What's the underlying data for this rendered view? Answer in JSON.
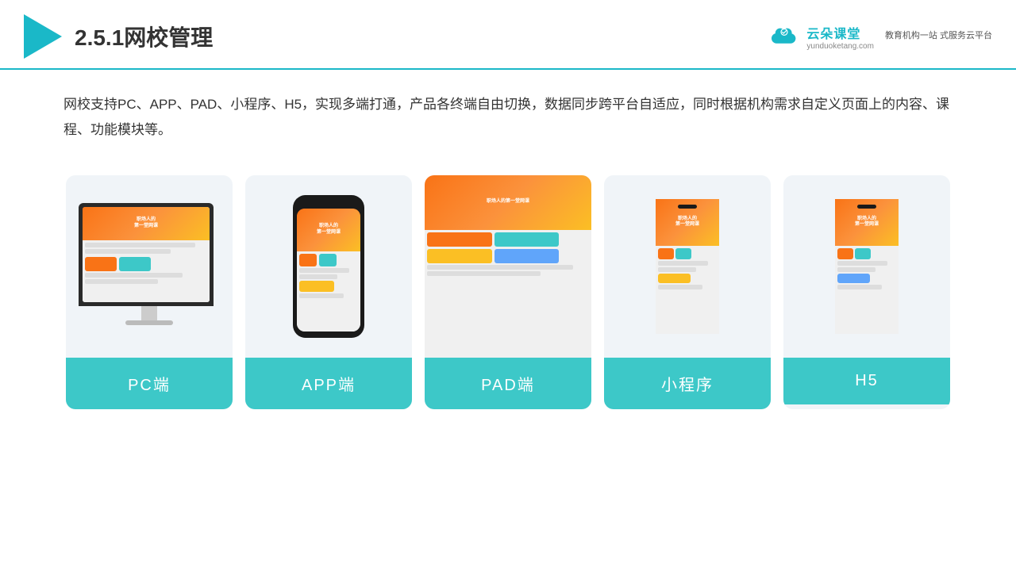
{
  "header": {
    "title": "2.5.1网校管理",
    "brand_name": "云朵课堂",
    "brand_url": "yunduoketang.com",
    "brand_tagline": "教育机构一站\n式服务云平台"
  },
  "description": {
    "text": "网校支持PC、APP、PAD、小程序、H5，实现多端打通，产品各终端自由切换，数据同步跨平台自适应，同时根据机构需求自定义页面上的内容、课程、功能模块等。"
  },
  "cards": [
    {
      "id": "pc",
      "label": "PC端"
    },
    {
      "id": "app",
      "label": "APP端"
    },
    {
      "id": "pad",
      "label": "PAD端"
    },
    {
      "id": "miniprogram",
      "label": "小程序"
    },
    {
      "id": "h5",
      "label": "H5"
    }
  ]
}
